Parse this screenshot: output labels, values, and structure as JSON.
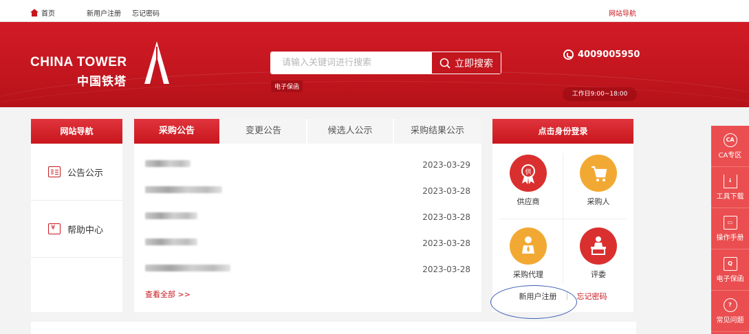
{
  "topbar": {
    "home": "首页",
    "register": "新用户注册",
    "forgot": "忘记密码",
    "site_nav": "网站导航"
  },
  "brand": {
    "en": "CHINA TOWER",
    "cn": "中国铁塔"
  },
  "search": {
    "placeholder": "请输入关键词进行搜索",
    "button": "立即搜索",
    "tag": "电子保函"
  },
  "contact": {
    "phone": "4009005950",
    "hours": "工作日9:00~18:00"
  },
  "left_nav": {
    "title": "网站导航",
    "items": [
      {
        "label": "公告公示",
        "icon": "notice-icon"
      },
      {
        "label": "帮助中心",
        "icon": "help-icon"
      }
    ]
  },
  "news": {
    "tabs": [
      "采购公告",
      "变更公告",
      "候选人公示",
      "采购结果公示"
    ],
    "active_tab": "采购公告",
    "rows": [
      {
        "date": "2023-03-29"
      },
      {
        "date": "2023-03-28"
      },
      {
        "date": "2023-03-28"
      },
      {
        "date": "2023-03-28"
      },
      {
        "date": "2023-03-28"
      }
    ],
    "more": "查看全部 >>"
  },
  "login": {
    "title": "点击身份登录",
    "roles": [
      {
        "label": "供应商",
        "icon": "supplier-icon",
        "color": "#d9302f"
      },
      {
        "label": "采购人",
        "icon": "cart-icon",
        "color": "#f2a933"
      },
      {
        "label": "采购代理",
        "icon": "agent-icon",
        "color": "#f2a933"
      },
      {
        "label": "评委",
        "icon": "judge-icon",
        "color": "#d9302f"
      }
    ],
    "register": "新用户注册",
    "forgot": "忘记密码"
  },
  "sidebar": {
    "items": [
      {
        "label": "CA专区",
        "glyph": "CA",
        "icon": "ca-icon"
      },
      {
        "label": "工具下载",
        "glyph": "↓",
        "icon": "download-icon"
      },
      {
        "label": "操作手册",
        "glyph": "▭",
        "icon": "manual-icon"
      },
      {
        "label": "电子保函",
        "glyph": "Q",
        "icon": "guarantee-icon"
      },
      {
        "label": "常见问题",
        "glyph": "?",
        "icon": "faq-icon"
      }
    ]
  },
  "colors": {
    "brand_red": "#c8161d",
    "sidebar_red": "#ea4e50",
    "gold": "#f2a933",
    "annotation_blue": "#3e5fb5"
  }
}
